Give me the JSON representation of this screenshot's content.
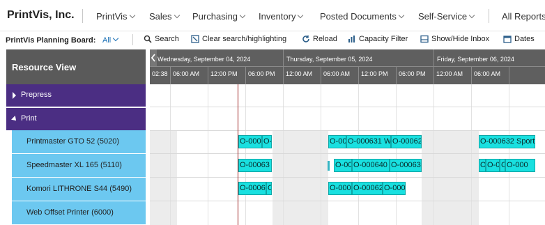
{
  "app": {
    "company": "PrintVis, Inc."
  },
  "nav": {
    "items": [
      "PrintVis",
      "Sales",
      "Purchasing",
      "Inventory",
      "Posted Documents",
      "Self-Service"
    ],
    "all_reports": "All Reports"
  },
  "actionbar": {
    "label": "PrintVis Planning Board:",
    "filter_value": "All",
    "buttons": [
      "Search",
      "Clear search/highlighting",
      "Reload",
      "Capacity Filter",
      "Show/Hide Inbox",
      "Dates"
    ]
  },
  "board": {
    "resource_view_title": "Resource View",
    "days": [
      "Wednesday, September 04, 2024",
      "Thursday, September 05, 2024",
      "Friday, September 06, 2024"
    ],
    "hours": [
      "02:38",
      "06:00 AM",
      "12:00 PM",
      "06:00 PM",
      "12:00 AM",
      "06:00 AM",
      "12:00 PM",
      "06:00 PM",
      "12:00 AM",
      "06:00 AM"
    ],
    "groups": [
      {
        "name": "Prepress",
        "expanded": false
      },
      {
        "name": "Print",
        "expanded": true
      }
    ],
    "resources": [
      {
        "name": "Printmaster GTO 52 (5020)"
      },
      {
        "name": "Speedmaster XL 165 (5110)"
      },
      {
        "name": "Komori LITHRONE S44 (5490)"
      },
      {
        "name": "Web Offset Printer (6000)"
      }
    ],
    "jobs": {
      "r1": [
        "O-000",
        "O-",
        "O-00",
        "O-000631 W",
        "O-00062",
        "O-000632 Sport"
      ],
      "r2": [
        "O-00063",
        "O-00",
        "O-000640",
        "O-00063",
        "O-",
        "O-00",
        "C",
        "O-000"
      ],
      "r3": [
        "O-0006",
        "O",
        "O-000",
        "O-00062",
        "O-000"
      ]
    },
    "colors": {
      "job_fill": "#19e0e0",
      "group_bg": "#4b2e83",
      "resource_bg": "#6cc8f0",
      "header_bg": "#5f5f5f",
      "now_line": "#9b1c1c"
    }
  }
}
